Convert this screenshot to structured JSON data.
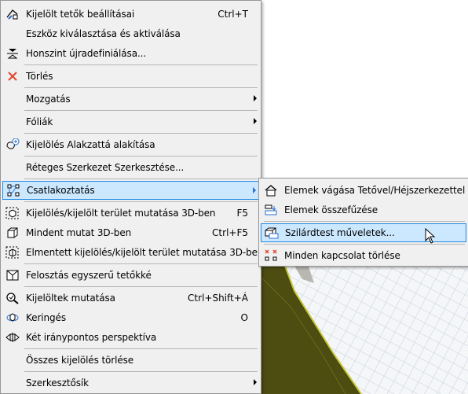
{
  "main_menu": {
    "items": [
      {
        "label": "Kijelölt tetők beállításai",
        "shortcut": "Ctrl+T",
        "icon": "roof-settings-icon"
      },
      {
        "label": "Eszköz kiválasztása és aktiválása",
        "shortcut": "",
        "icon": ""
      },
      {
        "label": "Honszint újradefiniálása...",
        "shortcut": "",
        "icon": "home-story-icon"
      },
      {
        "label": "Törlés",
        "shortcut": "",
        "icon": "delete-x-icon"
      },
      {
        "label": "Mozgatás",
        "shortcut": "",
        "icon": "",
        "submenu": true
      },
      {
        "label": "Fóliák",
        "shortcut": "",
        "icon": "",
        "submenu": true
      },
      {
        "label": "Kijelölés Alakzattá alakítása",
        "shortcut": "",
        "icon": "convert-to-morph-icon"
      },
      {
        "label": "Réteges Szerkezet Szerkesztése...",
        "shortcut": "",
        "icon": ""
      },
      {
        "label": "Csatlakoztatás",
        "shortcut": "",
        "icon": "connect-icon",
        "submenu": true
      },
      {
        "label": "Kijelölés/kijelölt terület mutatása 3D-ben",
        "shortcut": "F5",
        "icon": "show-selection-3d-icon"
      },
      {
        "label": "Mindent mutat 3D-ben",
        "shortcut": "Ctrl+F5",
        "icon": "show-all-3d-icon"
      },
      {
        "label": "Elmentett kijelölés/kijelölt terület mutatása 3D-ben",
        "shortcut": "",
        "icon": "saved-selection-3d-icon"
      },
      {
        "label": "Felosztás egyszerű tetőkké",
        "shortcut": "",
        "icon": "split-roofs-icon"
      },
      {
        "label": "Kijelöltek mutatása",
        "shortcut": "Ctrl+Shift+Á",
        "icon": "zoom-selection-icon"
      },
      {
        "label": "Keringés",
        "shortcut": "O",
        "icon": "orbit-icon"
      },
      {
        "label": "Két iránypontos perspektíva",
        "shortcut": "",
        "icon": "two-point-perspective-icon"
      },
      {
        "label": "Összes kijelölés törlése",
        "shortcut": "",
        "icon": ""
      },
      {
        "label": "Szerkesztősík",
        "shortcut": "",
        "icon": "",
        "submenu": true
      }
    ]
  },
  "sub_menu": {
    "items": [
      {
        "label": "Elemek vágása Tetővel/Héjszerkezettel",
        "icon": "trim-to-roof-icon"
      },
      {
        "label": "Elemek összefűzése",
        "icon": "merge-elements-icon"
      },
      {
        "label": "Szilárdtest műveletek...",
        "icon": "solid-operations-icon"
      },
      {
        "label": "Minden kapcsolat törlése",
        "icon": "remove-connections-icon"
      }
    ]
  },
  "colors": {
    "highlight": "#cce8ff",
    "highlight_border": "#2288e0",
    "menu_bg": "#f0f0f0",
    "model_fill": "#5a5a1a"
  }
}
